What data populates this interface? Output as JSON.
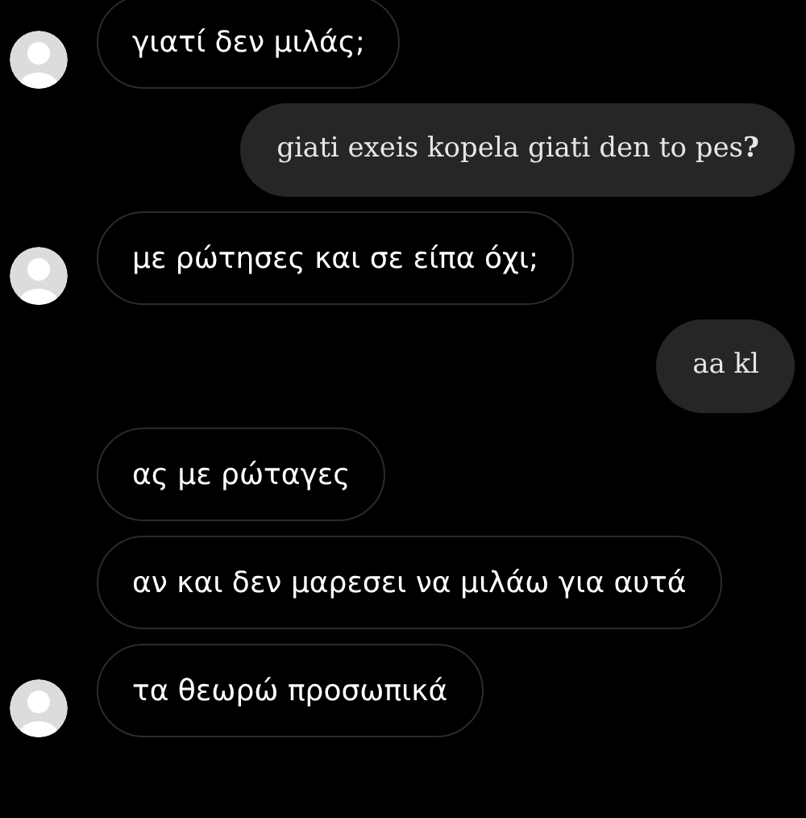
{
  "messages": [
    {
      "kind": "received",
      "avatar": true,
      "text": "γιατί δεν μιλάς;"
    },
    {
      "kind": "sent",
      "text": "giati exeis kopela giati den to pes**?**"
    },
    {
      "kind": "received",
      "avatar": true,
      "text": "με ρώτησες και σε είπα όχι;"
    },
    {
      "kind": "sent",
      "text": "aa kl"
    },
    {
      "kind": "received",
      "avatar": false,
      "text": "ας με ρώταγες"
    },
    {
      "kind": "received",
      "avatar": false,
      "text": "αν και δεν μαρεσει να μιλάω για αυτά"
    },
    {
      "kind": "received",
      "avatar": true,
      "text": "τα θεωρώ προσωπικά"
    }
  ]
}
